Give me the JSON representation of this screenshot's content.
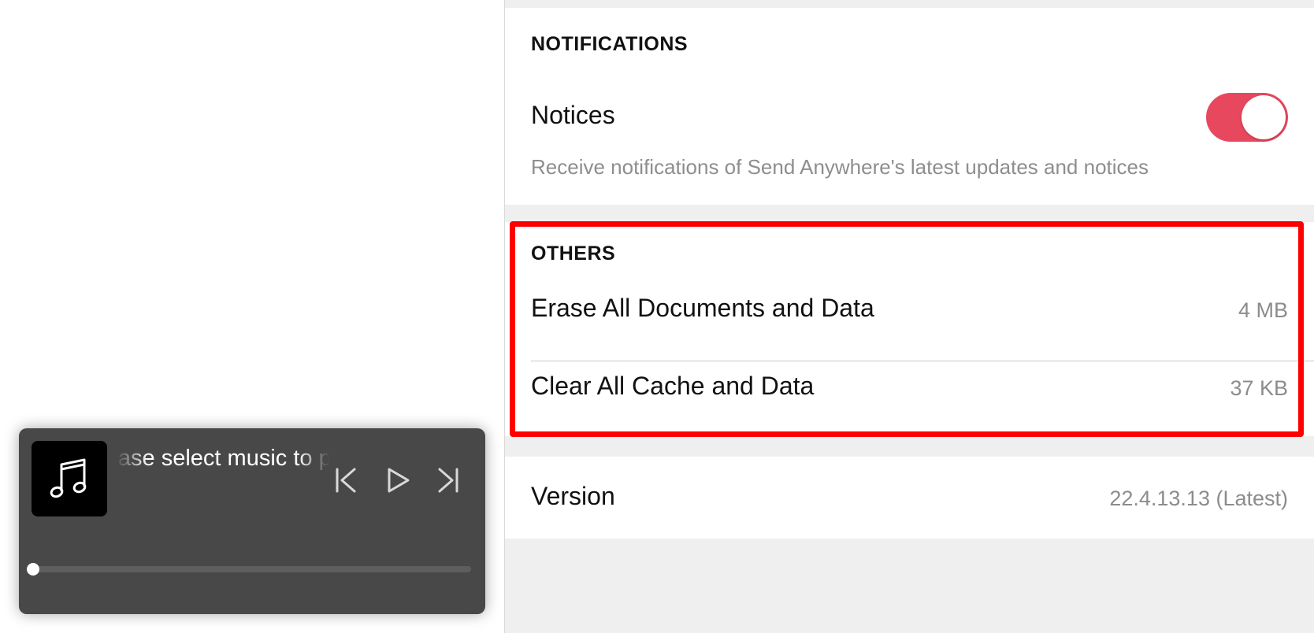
{
  "notifications": {
    "header": "NOTIFICATIONS",
    "notices_label": "Notices",
    "notices_enabled": true,
    "notices_description": "Receive notifications of Send Anywhere's latest updates and notices"
  },
  "others": {
    "header": "OTHERS",
    "erase_label": "Erase All Documents and Data",
    "erase_size": "4 MB",
    "clear_label": "Clear All Cache and Data",
    "clear_size": "37 KB"
  },
  "version": {
    "label": "Version",
    "value": "22.4.13.13 (Latest)"
  },
  "player": {
    "track_title": "Please select music to play",
    "icons": {
      "album": "music-note-icon",
      "previous": "skip-previous-icon",
      "play": "play-icon",
      "next": "skip-next-icon"
    },
    "progress": 0
  },
  "colors": {
    "toggle_on": "#e8485e",
    "highlight": "#ff0000",
    "pane_background": "#efefef"
  }
}
